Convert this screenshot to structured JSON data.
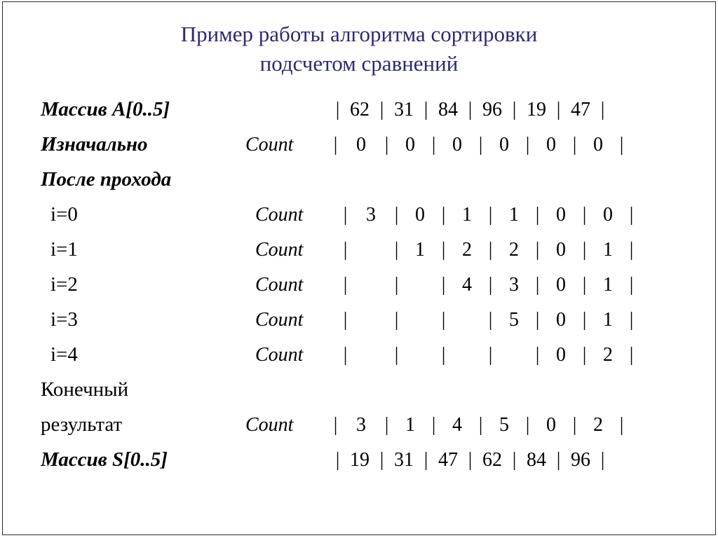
{
  "slide": {
    "title_line1": "Пример работы алгоритма сортировки",
    "title_line2": "подсчетом сравнений",
    "title_color": "#2c2a72",
    "text_color": "#000000",
    "background": "#ffffff"
  },
  "labels": {
    "array_a": "Массив A[0..5]",
    "initially": "Изначально",
    "after_pass": "После прохода",
    "final_line1": "Конечный",
    "final_line2": "результат",
    "array_s": "Массив S[0..5]",
    "count": "Count",
    "i0": "i=0",
    "i1": "i=1",
    "i2": "i=2",
    "i3": "i=3",
    "i4": "i=4",
    "bar": "|"
  },
  "chart_data": {
    "type": "table",
    "title": "Пример работы алгоритма сортировки подсчетом сравнений",
    "columns": 6,
    "rows": [
      {
        "label": "Массив A[0..5]",
        "sublabel": "",
        "values": [
          "62",
          "31",
          "84",
          "96",
          "19",
          "47"
        ]
      },
      {
        "label": "Изначально",
        "sublabel": "Count",
        "values": [
          "0",
          "0",
          "0",
          "0",
          "0",
          "0"
        ]
      },
      {
        "label": "i=0",
        "sublabel": "Count",
        "values": [
          "3",
          "0",
          "1",
          "1",
          "0",
          "0"
        ]
      },
      {
        "label": "i=1",
        "sublabel": "Count",
        "values": [
          "",
          "1",
          "2",
          "2",
          "0",
          "1"
        ]
      },
      {
        "label": "i=2",
        "sublabel": "Count",
        "values": [
          "",
          "",
          "4",
          "3",
          "0",
          "1"
        ]
      },
      {
        "label": "i=3",
        "sublabel": "Count",
        "values": [
          "",
          "",
          "",
          "5",
          "0",
          "1"
        ]
      },
      {
        "label": "i=4",
        "sublabel": "Count",
        "values": [
          "",
          "",
          "",
          "",
          "0",
          "2"
        ]
      },
      {
        "label": "Конечный результат",
        "sublabel": "Count",
        "values": [
          "3",
          "1",
          "4",
          "5",
          "0",
          "2"
        ]
      },
      {
        "label": "Массив S[0..5]",
        "sublabel": "",
        "values": [
          "19",
          "31",
          "47",
          "62",
          "84",
          "96"
        ]
      }
    ]
  }
}
